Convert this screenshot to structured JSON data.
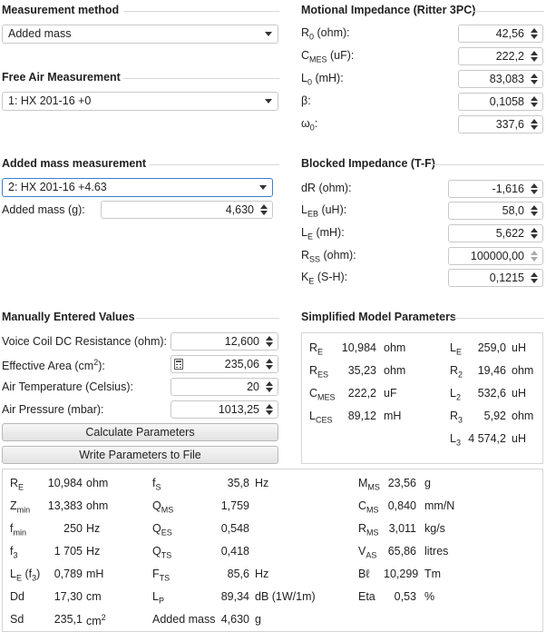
{
  "measurement_method": {
    "title": "Measurement method",
    "selected": "Added mass"
  },
  "free_air": {
    "title": "Free Air Measurement",
    "selected": "1: HX 201-16 +0"
  },
  "added_mass_meas": {
    "title": "Added mass measurement",
    "selected": "2: HX 201-16 +4.63",
    "mass_label": "Added mass (g):",
    "mass_value": "4,630"
  },
  "motional": {
    "title": "Motional Impedance (Ritter 3PC)",
    "rows": [
      {
        "sym": "R",
        "sub": "0",
        "unit": " (ohm):",
        "value": "42,56"
      },
      {
        "sym": "C",
        "sub": "MES",
        "unit": " (uF):",
        "value": "222,2"
      },
      {
        "sym": "L",
        "sub": "0",
        "unit": " (mH):",
        "value": "83,083"
      },
      {
        "sym": "β:",
        "sub": "",
        "unit": "",
        "value": "0,1058"
      },
      {
        "sym": "ω",
        "sub": "0",
        "unit": ":",
        "value": "337,6"
      }
    ]
  },
  "blocked": {
    "title": "Blocked Impedance (T-F)",
    "rows": [
      {
        "sym": "dR (ohm):",
        "sub": "",
        "unit": "",
        "value": "-1,616"
      },
      {
        "sym": "L",
        "sub": "EB",
        "unit": " (uH):",
        "value": "58,0"
      },
      {
        "sym": "L",
        "sub": "E",
        "unit": " (mH):",
        "value": "5,622"
      },
      {
        "sym": "R",
        "sub": "SS",
        "unit": " (ohm):",
        "value": "100000,00"
      },
      {
        "sym": "K",
        "sub": "E",
        "unit": " (S-H):",
        "value": "0,1215"
      }
    ]
  },
  "manual": {
    "title": "Manually Entered Values",
    "rows": [
      {
        "label": "Voice Coil DC Resistance (ohm):",
        "value": "12,600"
      },
      {
        "label": "Effective Area (cm",
        "sup": "2",
        "label_end": "):",
        "value": "235,06"
      },
      {
        "label": "Air Temperature (Celsius):",
        "value": "20"
      },
      {
        "label": "Air Pressure (mbar):",
        "value": "1013,25"
      }
    ],
    "calc_button": "Calculate Parameters",
    "write_button": "Write Parameters to File"
  },
  "simplified": {
    "title": "Simplified Model Parameters",
    "left": [
      {
        "sym": "R",
        "sub": "E",
        "value": "10,984",
        "unit": "ohm"
      },
      {
        "sym": "R",
        "sub": "ES",
        "value": "35,23",
        "unit": "ohm"
      },
      {
        "sym": "C",
        "sub": "MES",
        "value": "222,2",
        "unit": "uF"
      },
      {
        "sym": "L",
        "sub": "CES",
        "value": "89,12",
        "unit": "mH"
      }
    ],
    "right": [
      {
        "sym": "L",
        "sub": "E",
        "value": "259,0",
        "unit": "uH"
      },
      {
        "sym": "R",
        "sub": "2",
        "value": "19,46",
        "unit": "ohm"
      },
      {
        "sym": "L",
        "sub": "2",
        "value": "532,6",
        "unit": "uH"
      },
      {
        "sym": "R",
        "sub": "3",
        "value": "5,92",
        "unit": "ohm"
      },
      {
        "sym": "L",
        "sub": "3",
        "value": "4 574,2",
        "unit": "uH"
      }
    ]
  },
  "results": {
    "col1": [
      {
        "sym": "R",
        "sub": "E",
        "value": "10,984",
        "unit": "ohm"
      },
      {
        "sym": "Z",
        "sub": "min",
        "value": "13,383",
        "unit": "ohm"
      },
      {
        "sym": "f",
        "sub": "min",
        "value": "250",
        "unit": "Hz"
      },
      {
        "sym": "f",
        "sub": "3",
        "value": "1 705",
        "unit": "Hz"
      },
      {
        "sym": "L",
        "sub": "E",
        "extra": "(f",
        "extra_sub": "3",
        "extra_end": ")",
        "value": "0,789",
        "unit": "mH"
      },
      {
        "sym": "Dd",
        "sub": "",
        "value": "17,30",
        "unit": "cm"
      },
      {
        "sym": "Sd",
        "sub": "",
        "value": "235,1",
        "unit": "cm",
        "unit_sup": "2"
      }
    ],
    "col2": [
      {
        "sym": "f",
        "sub": "S",
        "value": "35,8",
        "unit": "Hz"
      },
      {
        "sym": "Q",
        "sub": "MS",
        "value": "1,759",
        "unit": ""
      },
      {
        "sym": "Q",
        "sub": "ES",
        "value": "0,548",
        "unit": ""
      },
      {
        "sym": "Q",
        "sub": "TS",
        "value": "0,418",
        "unit": ""
      },
      {
        "sym": "F",
        "sub": "TS",
        "value": "85,6",
        "unit": "Hz"
      },
      {
        "sym": "L",
        "sub": "P",
        "value": "89,34",
        "unit": "dB (1W/1m)"
      },
      {
        "sym": "Added mass",
        "sub": "",
        "value": "4,630",
        "unit": "g"
      }
    ],
    "col3": [
      {
        "sym": "M",
        "sub": "MS",
        "value": "23,56",
        "unit": "g"
      },
      {
        "sym": "C",
        "sub": "MS",
        "value": "0,840",
        "unit": "mm/N"
      },
      {
        "sym": "R",
        "sub": "MS",
        "value": "3,011",
        "unit": "kg/s"
      },
      {
        "sym": "V",
        "sub": "AS",
        "value": "65,86",
        "unit": "litres"
      },
      {
        "sym": "Bℓ",
        "sub": "",
        "value": "10,299",
        "unit": "Tm"
      },
      {
        "sym": "Eta",
        "sub": "",
        "value": "0,53",
        "unit": "%"
      }
    ]
  }
}
